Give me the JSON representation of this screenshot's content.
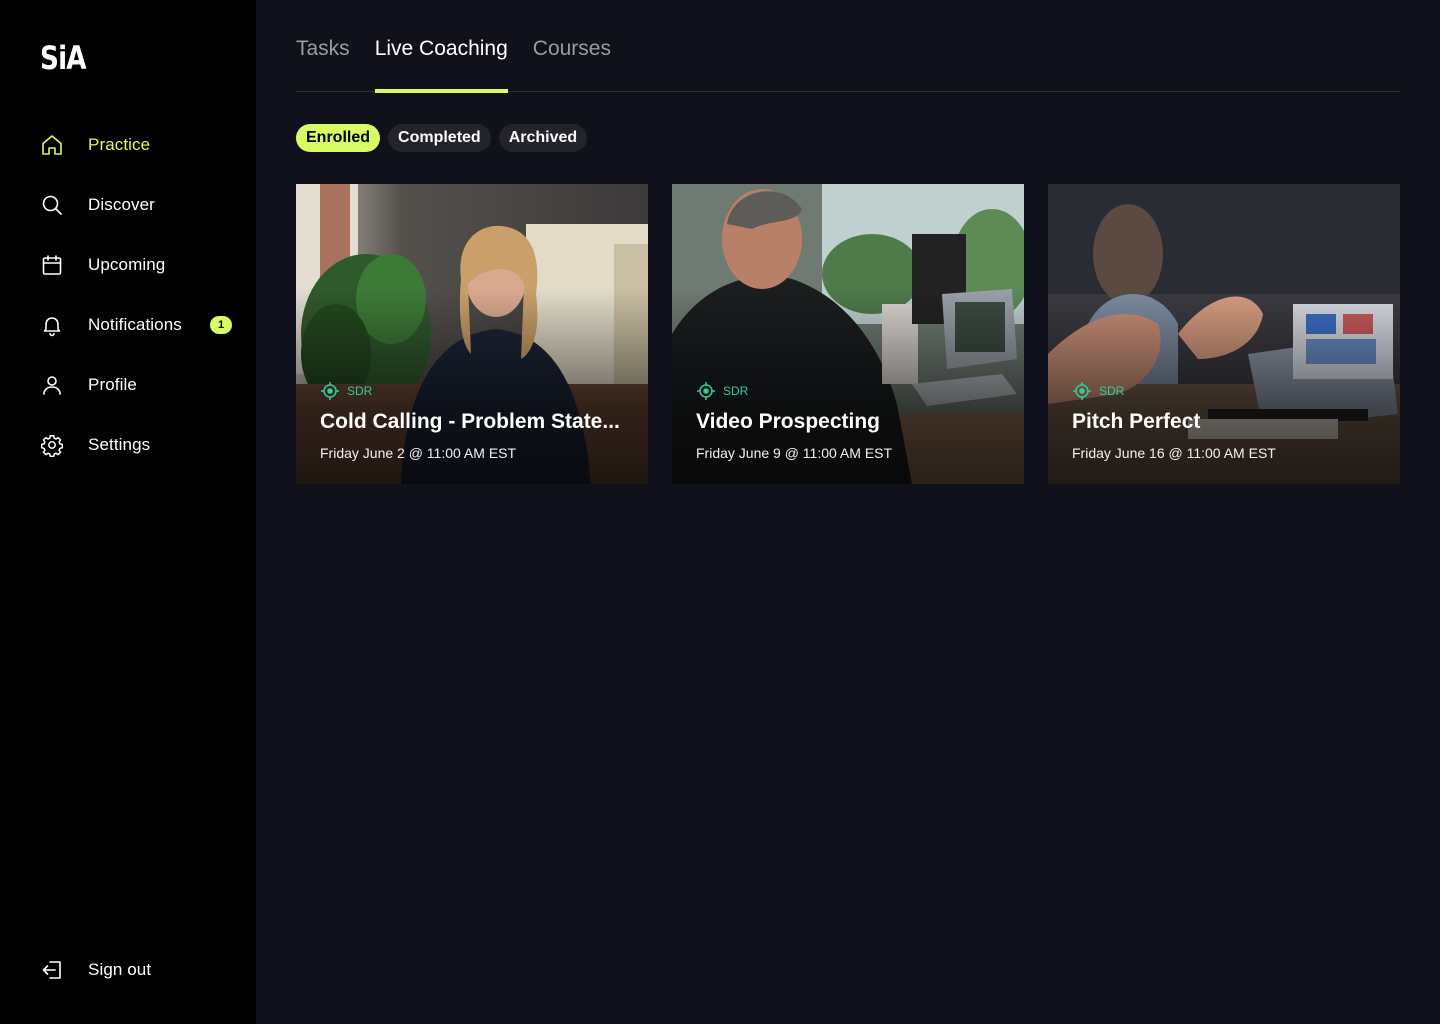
{
  "app": {
    "logo_text": "SiA"
  },
  "sidebar": {
    "items": [
      {
        "label": "Practice",
        "icon": "home-icon",
        "active": true
      },
      {
        "label": "Discover",
        "icon": "search-icon"
      },
      {
        "label": "Upcoming",
        "icon": "calendar-icon"
      },
      {
        "label": "Notifications",
        "icon": "bell-icon",
        "badge": "1"
      },
      {
        "label": "Profile",
        "icon": "user-icon"
      },
      {
        "label": "Settings",
        "icon": "gear-icon"
      }
    ],
    "signout_label": "Sign out"
  },
  "tabs": [
    {
      "label": "Tasks"
    },
    {
      "label": "Live Coaching",
      "active": true
    },
    {
      "label": "Courses"
    }
  ],
  "filters": [
    {
      "label": "Enrolled",
      "active": true
    },
    {
      "label": "Completed"
    },
    {
      "label": "Archived"
    }
  ],
  "cards": [
    {
      "tag": "SDR",
      "title": "Cold Calling - Problem State...",
      "date": "Friday June 2 @ 11:00 AM EST"
    },
    {
      "tag": "SDR",
      "title": "Video Prospecting",
      "date": "Friday June 9 @ 11:00 AM EST"
    },
    {
      "tag": "SDR",
      "title": "Pitch Perfect",
      "date": "Friday June 16 @ 11:00 AM EST"
    }
  ],
  "colors": {
    "accent": "#d9fb63",
    "tag": "#2ecf9b",
    "sidebar_bg": "#000000",
    "main_bg": "#10111a"
  }
}
